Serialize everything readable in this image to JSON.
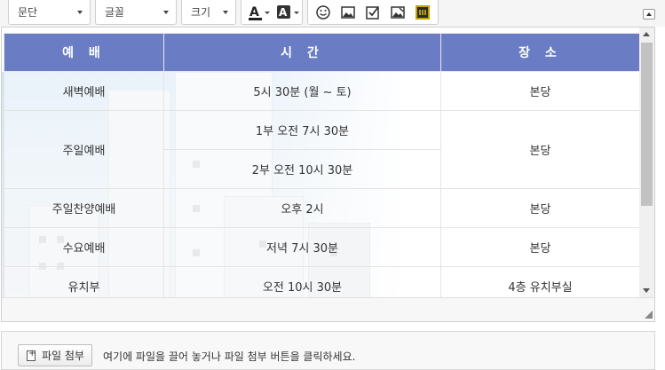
{
  "toolbar": {
    "paragraph_select": "문단",
    "font_select": "글꼴",
    "size_select": "크기",
    "font_color_label": "A",
    "bg_color_label": "A"
  },
  "table": {
    "headers": [
      "예 배",
      "시 간",
      "장 소"
    ],
    "rows": [
      {
        "name": "새벽예배",
        "time": "5시 30분 (월 ~ 토)",
        "place": "본당"
      },
      {
        "name": "주일예배",
        "time": "1부 오전 7시 30분",
        "time2": "2부 오전 10시 30분",
        "place": "본당"
      },
      {
        "name": "주일찬양예배",
        "time": "오후 2시",
        "place": "본당"
      },
      {
        "name": "수요예배",
        "time": "저녁 7시 30분",
        "place": "본당"
      },
      {
        "name": "유치부",
        "time": "오전 10시 30분",
        "place": "4층 유치부실"
      }
    ]
  },
  "attach": {
    "button_label": "파일 첨부",
    "hint": "여기에 파일을 끌어 놓거나 파일 첨부 버튼을 클릭하세요."
  },
  "colors": {
    "header_bg": "#6a7dc4",
    "toolbar_bg": "#f5f5f5"
  },
  "icons": [
    "caret-down-icon",
    "font-color-icon",
    "background-color-icon",
    "emoticon-icon",
    "image-icon",
    "checkbox-icon",
    "photo-edit-icon",
    "video-icon",
    "collapse-toolbar-icon",
    "file-add-icon",
    "resize-grip-icon"
  ]
}
